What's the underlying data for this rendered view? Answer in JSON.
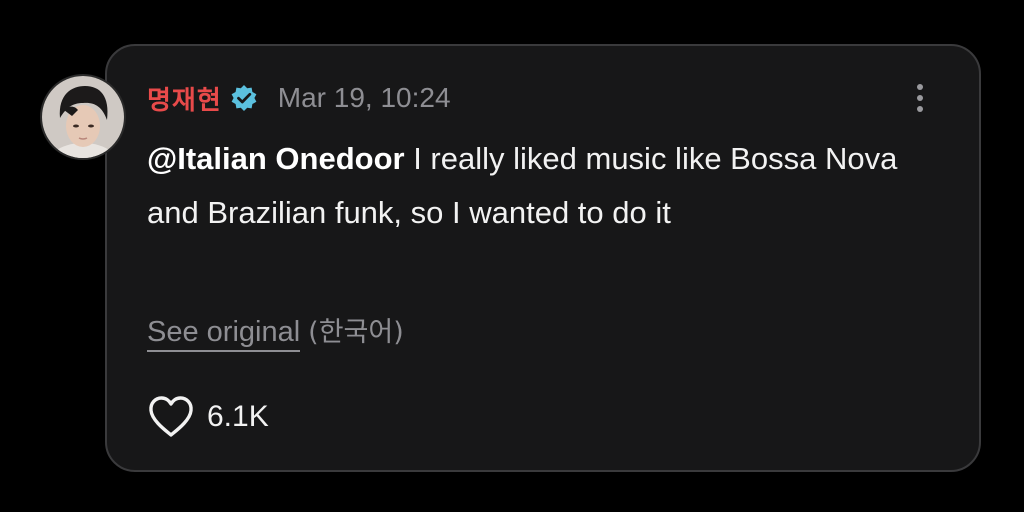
{
  "comment": {
    "author": "명재현",
    "verified_icon": "verified-badge-icon",
    "timestamp": "Mar 19, 10:24",
    "mention": "@Italian Onedoor",
    "text": " I really liked music like Bossa Nova and Brazilian funk, so I wanted to do it",
    "see_original_label": "See original",
    "original_language": "(한국어)",
    "like_count": "6.1K"
  },
  "colors": {
    "author": "#e84a4a",
    "verified": "#5bc0de",
    "card_background": "#171718",
    "muted_text": "#8e8e93"
  }
}
